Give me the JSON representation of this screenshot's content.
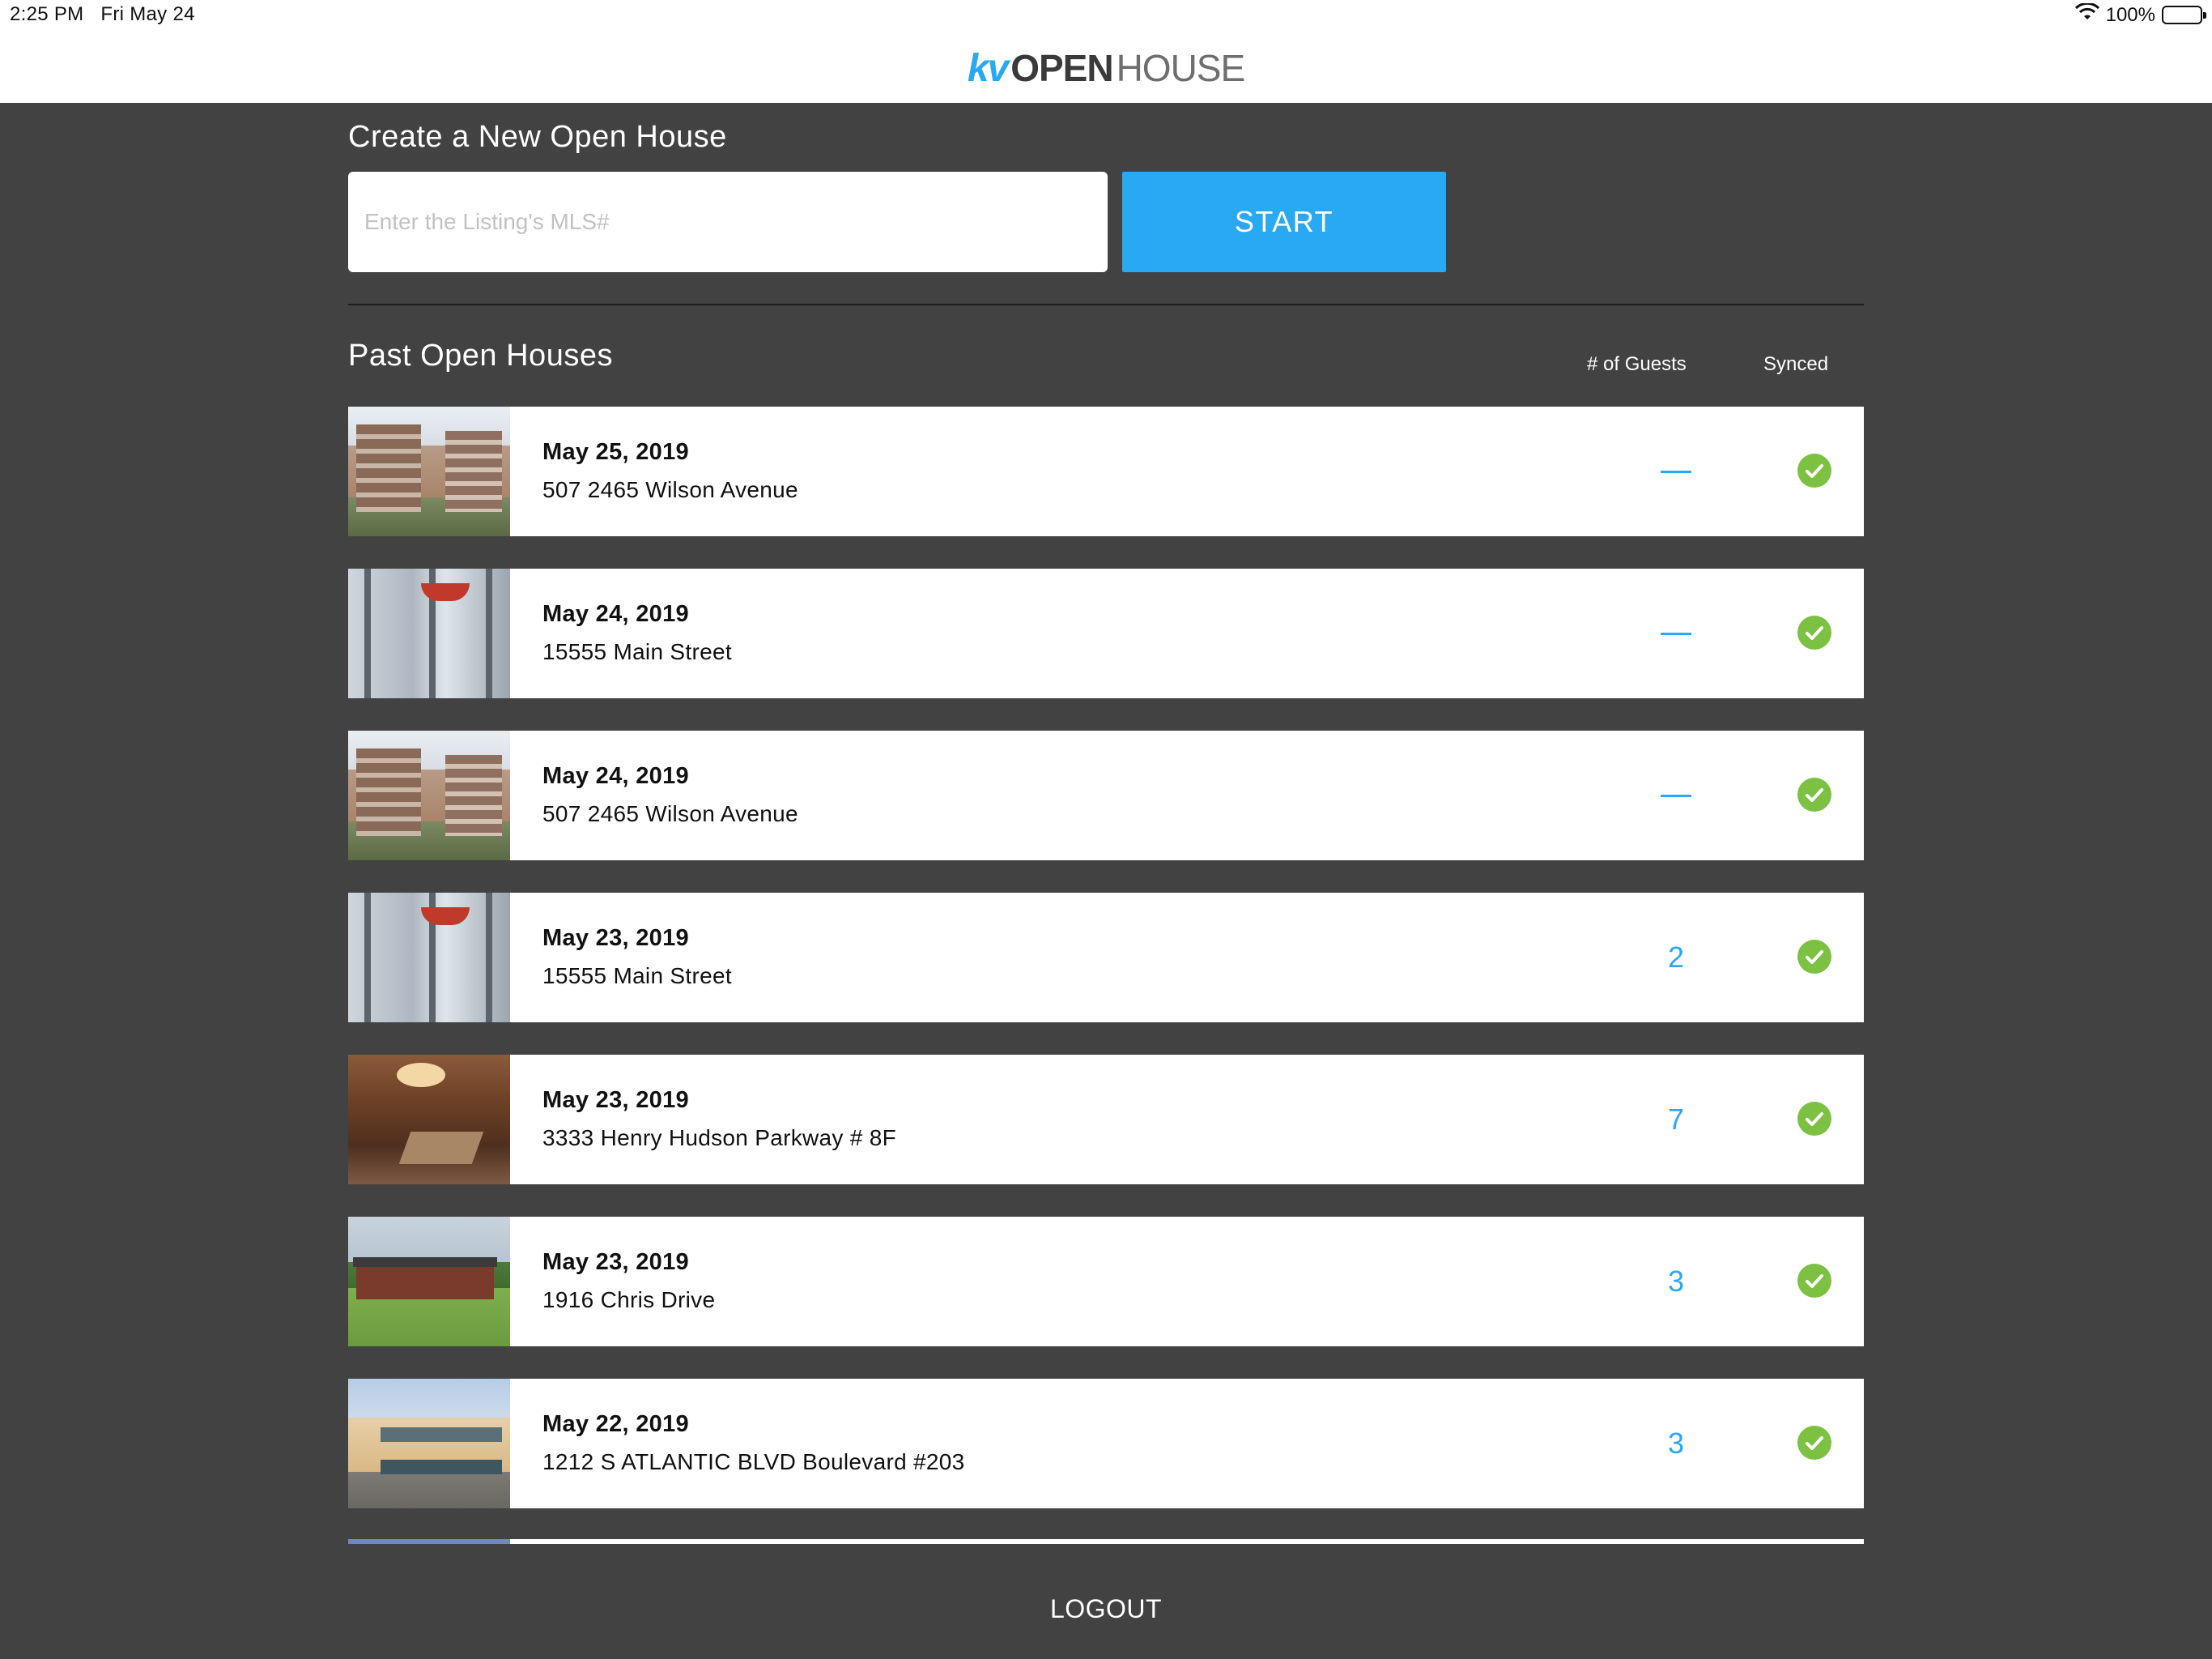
{
  "status_bar": {
    "time": "2:25 PM",
    "date": "Fri May 24",
    "battery": "100%"
  },
  "header": {
    "logo_kv": "kv",
    "logo_open": "OPEN",
    "logo_house": "HOUSE"
  },
  "create": {
    "title": "Create a New Open House",
    "input_placeholder": "Enter the Listing's MLS#",
    "start_label": "START"
  },
  "past": {
    "title": "Past Open Houses",
    "col_guests": "# of Guests",
    "col_synced": "Synced",
    "rows": [
      {
        "date": "May 25, 2019",
        "address": "507 2465 Wilson Avenue",
        "guests": "",
        "synced": true,
        "thumb": "condo"
      },
      {
        "date": "May 24, 2019",
        "address": "15555 Main Street",
        "guests": "",
        "synced": true,
        "thumb": "office"
      },
      {
        "date": "May 24, 2019",
        "address": "507 2465 Wilson Avenue",
        "guests": "",
        "synced": true,
        "thumb": "condo"
      },
      {
        "date": "May 23, 2019",
        "address": "15555 Main Street",
        "guests": "2",
        "synced": true,
        "thumb": "office"
      },
      {
        "date": "May 23, 2019",
        "address": "3333 Henry Hudson Parkway # 8F",
        "guests": "7",
        "synced": true,
        "thumb": "lobby"
      },
      {
        "date": "May 23, 2019",
        "address": "1916 Chris Drive",
        "guests": "3",
        "synced": true,
        "thumb": "house"
      },
      {
        "date": "May 22, 2019",
        "address": "1212 S ATLANTIC BLVD Boulevard #203",
        "guests": "3",
        "synced": true,
        "thumb": "plaza"
      }
    ]
  },
  "footer": {
    "logout_label": "LOGOUT"
  },
  "colors": {
    "accent": "#29a9f2",
    "background": "#424242",
    "synced_green": "#7cc142"
  }
}
